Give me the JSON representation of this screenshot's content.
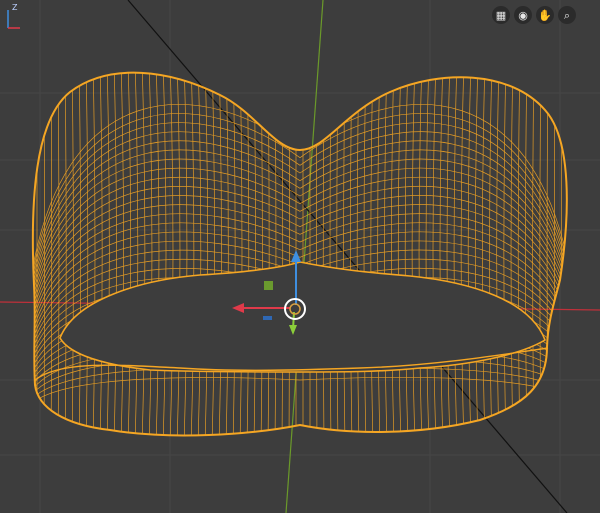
{
  "app": "3D Viewport",
  "toolbar": {
    "buttons": [
      {
        "name": "toggle-grid-icon",
        "glyph": "▦"
      },
      {
        "name": "camera-view-icon",
        "glyph": "◉"
      },
      {
        "name": "pan-hand-icon",
        "glyph": "✋"
      },
      {
        "name": "zoom-icon",
        "glyph": "⌕"
      }
    ]
  },
  "axis_gizmo": {
    "z_label": "Z"
  },
  "colors": {
    "background": "#3d3d3d",
    "grid": "#474747",
    "x_axis": "#c0303a",
    "y_axis": "#6b9a2a",
    "wire": "#f5a623",
    "black_line": "#111111",
    "gizmo_z": "#3f8fe0",
    "gizmo_x": "#e03a4a",
    "gizmo_y": "#8ccf3a"
  },
  "object": {
    "name": "wireframe-mesh",
    "selected": true
  }
}
